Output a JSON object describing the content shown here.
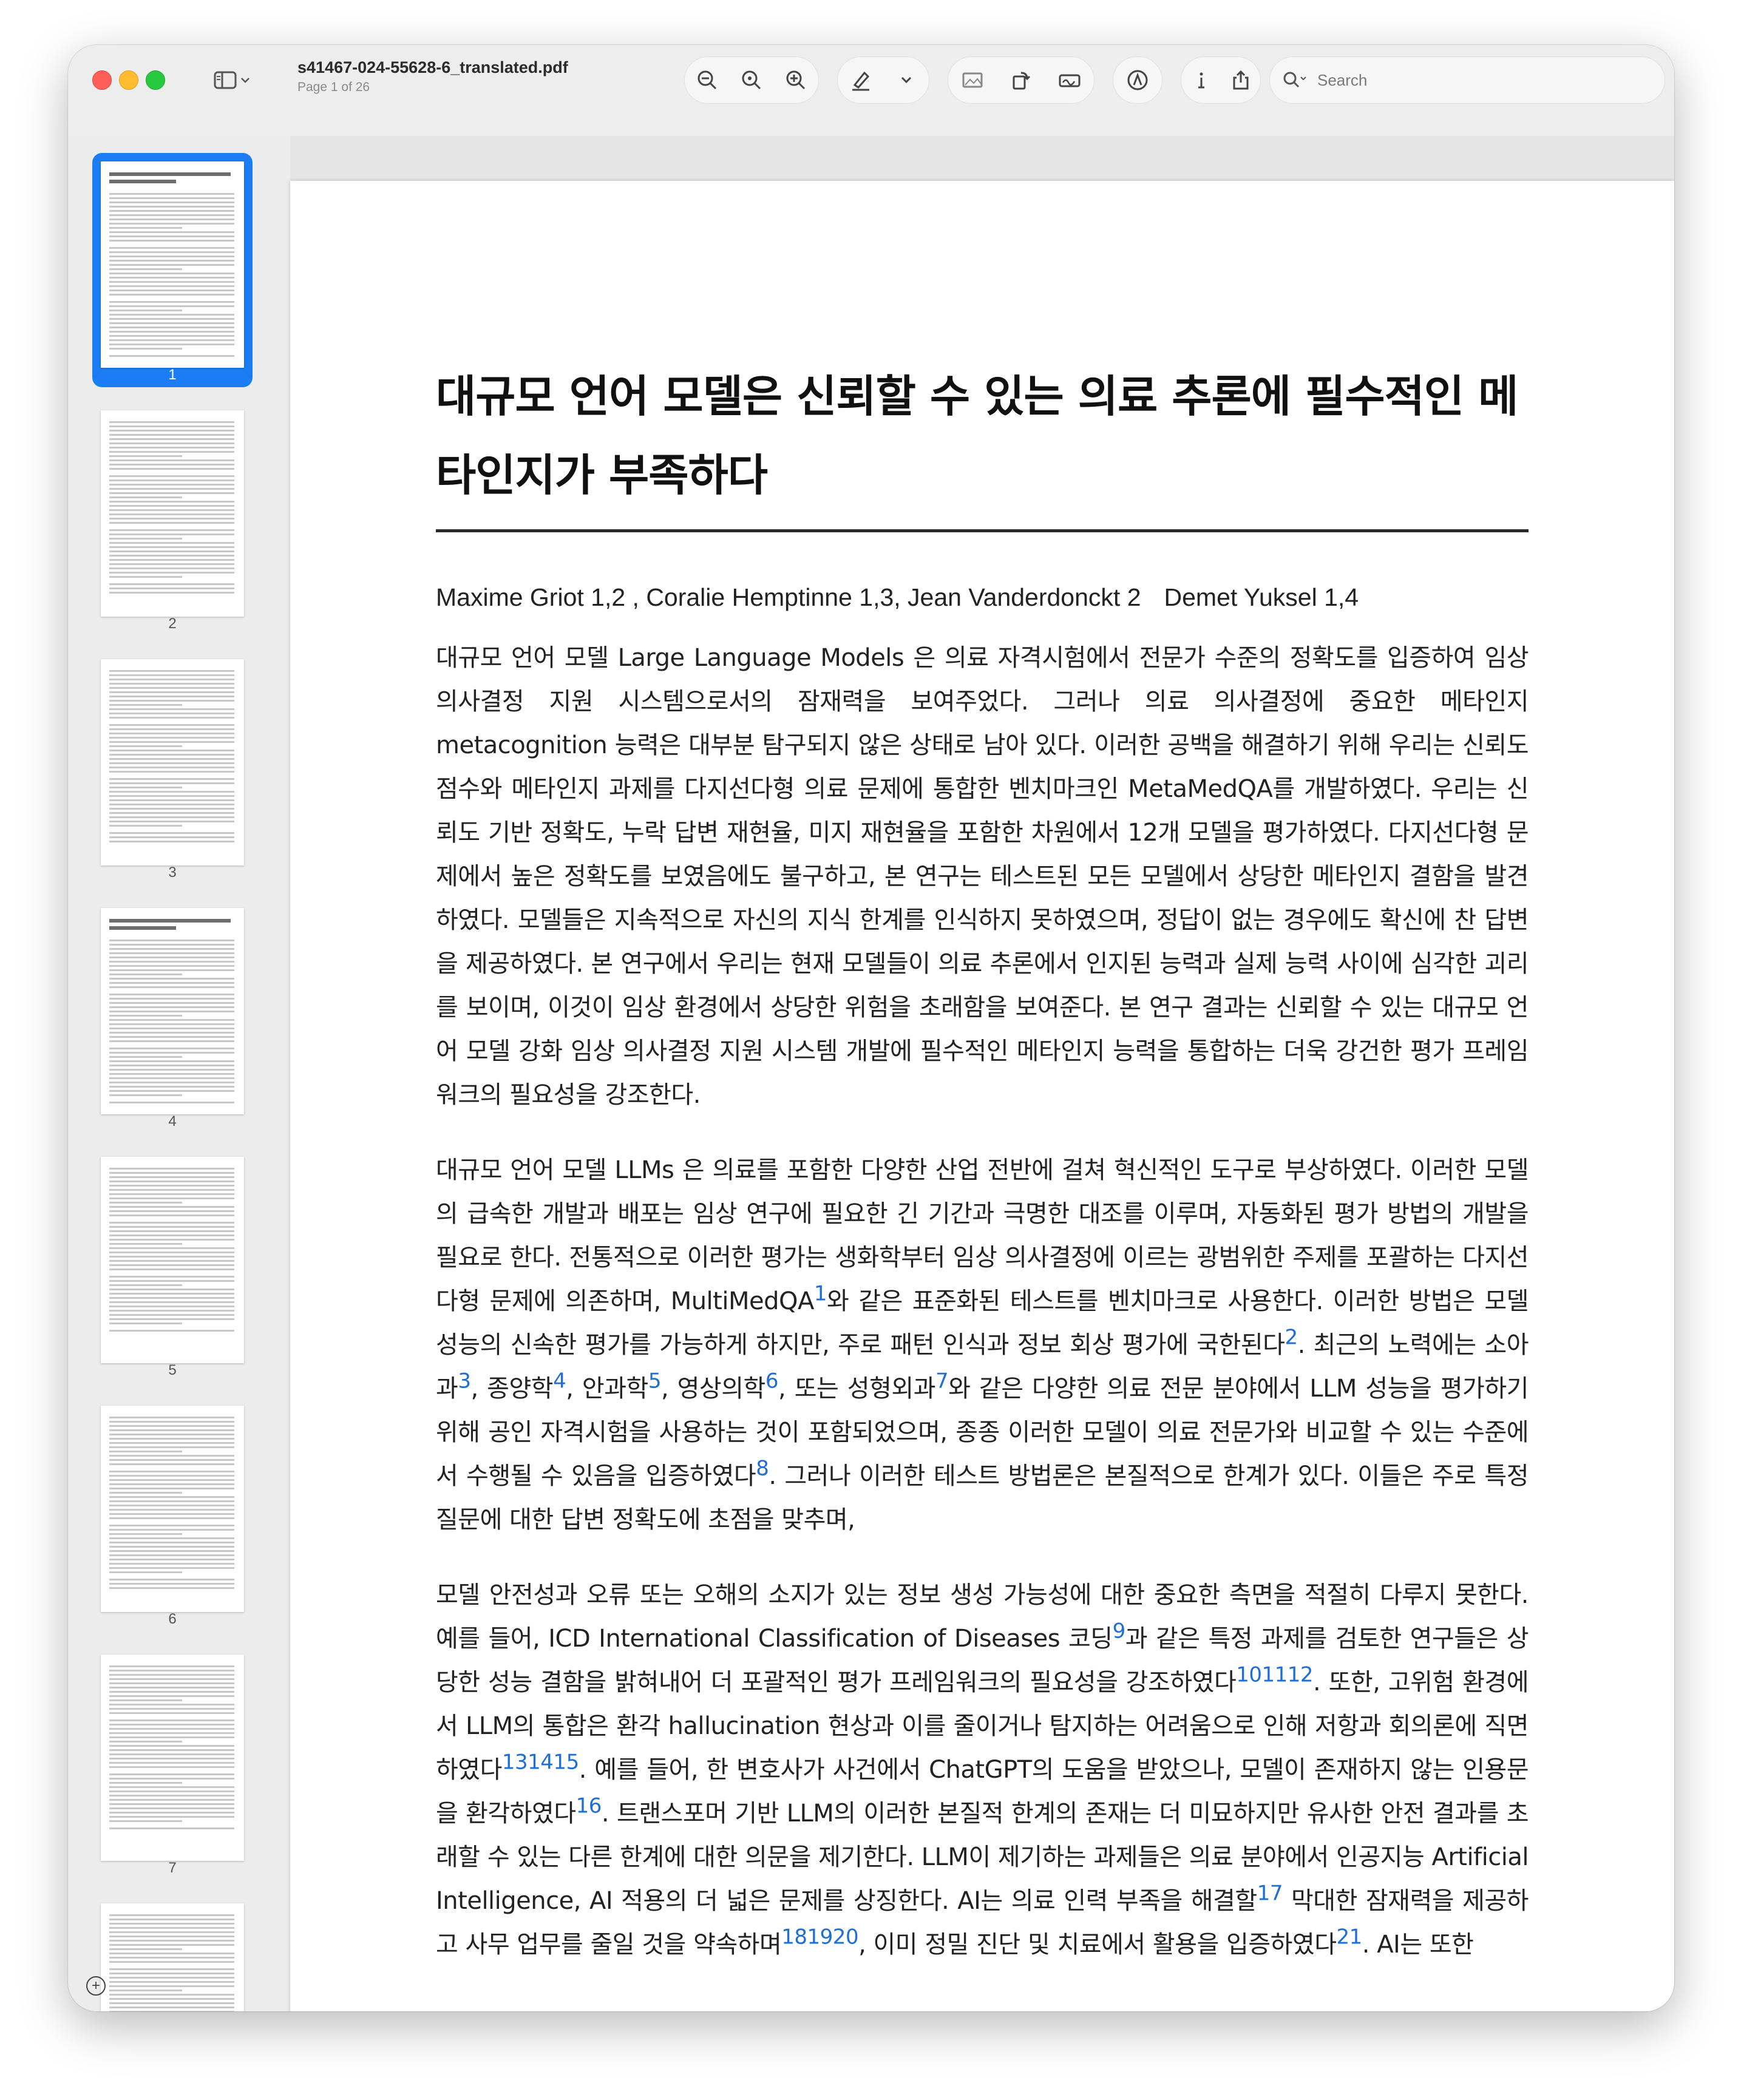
{
  "window": {
    "filename": "s41467-024-55628-6_translated.pdf",
    "page_indicator": "Page 1 of 26"
  },
  "toolbar": {
    "buttons": [
      "zoom-out-icon",
      "zoom-actual-icon",
      "zoom-in-icon",
      "highlight-pen-icon",
      "chevron-down-icon",
      "select-image-icon",
      "rotate-icon",
      "sign-icon",
      "markup-icon",
      "info-icon",
      "share-icon"
    ]
  },
  "search": {
    "placeholder": "Search"
  },
  "sidebar": {
    "thumbnails": [
      "1",
      "2",
      "3",
      "4",
      "5",
      "6",
      "7"
    ]
  },
  "article": {
    "title": "대규모 언어 모델은 신뢰할 수 있는 의료 추론에 필수적인 메타인지가 부족하다",
    "authors": [
      "Maxime Griot 1,2 , Coralie Hemptinne 1,3, Jean Vanderdonckt 2",
      "Demet Yuksel 1,4"
    ],
    "abstract": "대규모 언어 모델 Large Language Models 은 의료 자격시험에서 전문가 수준의 정확도를 입증하여 임상 의사결정 지원 시스템으로서의 잠재력을 보여주었다. 그러나 의료 의사결정에 중요한 메타인지 metacognition 능력은 대부분 탐구되지 않은 상태로 남아 있다. 이러한 공백을 해결하기 위해 우리는 신뢰도 점수와 메타인지 과제를 다지선다형 의료 문제에 통합한 벤치마크인 MetaMedQA를 개발하였다. 우리는 신뢰도 기반 정확도, 누락 답변 재현율, 미지 재현율을 포함한 차원에서 12개 모델을 평가하였다. 다지선다형 문제에서 높은 정확도를 보였음에도 불구하고, 본 연구는 테스트된 모든 모델에서 상당한 메타인지 결함을 발견하였다. 모델들은 지속적으로 자신의 지식 한계를 인식하지 못하였으며, 정답이 없는 경우에도 확신에 찬 답변을 제공하였다. 본 연구에서 우리는 현재 모델들이 의료 추론에서 인지된 능력과 실제 능력 사이에 심각한 괴리를 보이며, 이것이 임상 환경에서 상당한 위험을 초래함을 보여준다. 본 연구 결과는 신뢰할 수 있는 대규모 언어 모델 강화 임상 의사결정 지원 시스템 개발에 필수적인 메타인지 능력을 통합하는 더욱 강건한 평가 프레임워크의 필요성을 강조한다.",
    "p2": [
      "대규모 언어 모델 LLMs 은 의료를 포함한 다양한 산업 전반에 걸쳐 혁신적인 도구로 부상하였다. 이러한 모델의 급속한 개발과 배포는 임상 연구에 필요한 긴 기간과 극명한 대조를 이루며, 자동화된 평가 방법의 개발을 필요로 한다. 전통적으로 이러한 평가는 생화학부터 임상 의사결정에 이르는 광범위한 주제를 포괄하는 다지선다형 문제에 의존하며, MultiMedQA",
      "1",
      "와 같은 표준화된 테스트를 벤치마크로 사용한다. 이러한 방법은 모델 성능의 신속한 평가를 가능하게 하지만, 주로 패턴 인식과 정보 회상 평가에 국한된다",
      "2",
      ". 최근의 노력에는 소아과",
      "3",
      ", 종양학",
      "4",
      ", 안과학",
      "5",
      ", 영상의학",
      "6",
      ", 또는 성형외과",
      "7",
      "와 같은 다양한 의료 전문 분야에서 LLM 성능을 평가하기 위해 공인 자격시험을 사용하는 것이 포함되었으며, 종종 이러한 모델이 의료 전문가와 비교할 수 있는 수준에서 수행될 수 있음을 입증하였다",
      "8",
      ". 그러나 이러한 테스트 방법론은 본질적으로 한계가 있다. 이들은 주로 특정 질문에 대한 답변 정확도에 초점을 맞추며,"
    ],
    "p3": [
      "모델 안전성과 오류 또는 오해의 소지가 있는 정보 생성 가능성에 대한 중요한 측면을 적절히 다루지 못한다. 예를 들어, ICD International Classification of Diseases  코딩",
      "9",
      "과 같은 특정 과제를 검토한 연구들은 상당한 성능 결함을 밝혀내어 더 포괄적인 평가 프레임워크의 필요성을 강조하였다",
      "101112",
      ". 또한, 고위험 환경에서 LLM의 통합은 환각 hallucination  현상과 이를 줄이거나 탐지하는 어려움으로 인해 저항과 회의론에 직면하였다",
      "131415",
      ". 예를 들어, 한 변호사가 사건에서 ChatGPT의 도움을 받았으나, 모델이 존재하지 않는 인용문을 환각하였다",
      "16",
      ". 트랜스포머 기반 LLM의 이러한 본질적 한계의 존재는 더 미묘하지만 유사한 안전 결과를 초래할 수 있는 다른 한계에 대한 의문을 제기한다. LLM이 제기하는 과제들은 의료 분야에서 인공지능 Artificial Intelligence, AI  적용의 더 넓은 문제를 상징한다. AI는 의료 인력 부족을 해결할",
      "17",
      " 막대한 잠재력을 제공하고 사무 업무를 줄일 것을 약속하며",
      "181920",
      ", 이미 정밀 진단 및 치료에서 활용을 입증하였다",
      "21",
      ". AI는 또한"
    ]
  }
}
